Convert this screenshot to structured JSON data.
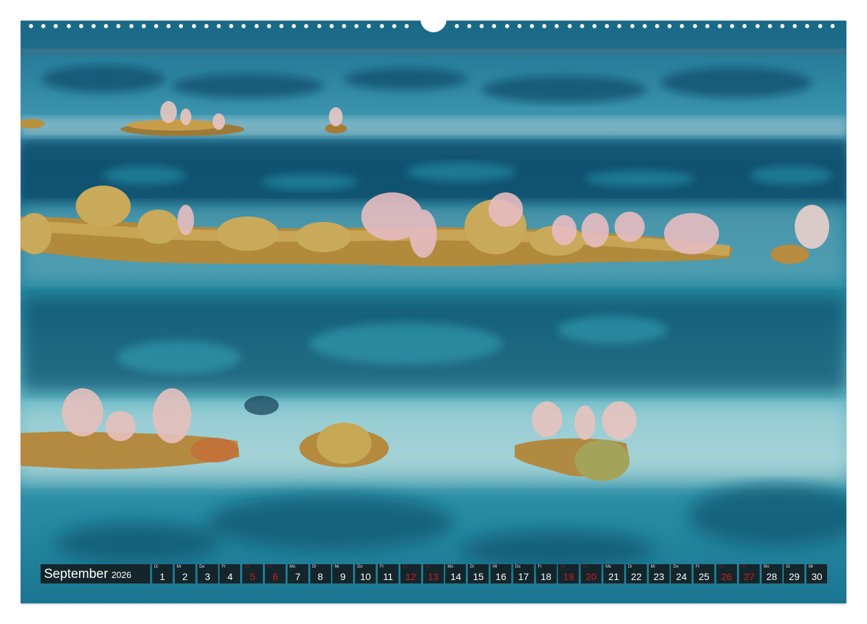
{
  "calendar": {
    "month": "September",
    "year": "2026",
    "colors": {
      "box": "#141e22",
      "text": "#ffffff",
      "weekend": "#d11b22"
    },
    "days": [
      {
        "wd": "Di",
        "num": "1",
        "weekend": false
      },
      {
        "wd": "Mi",
        "num": "2",
        "weekend": false
      },
      {
        "wd": "Do",
        "num": "3",
        "weekend": false
      },
      {
        "wd": "Fr",
        "num": "4",
        "weekend": false
      },
      {
        "wd": "Sa",
        "num": "5",
        "weekend": true
      },
      {
        "wd": "So",
        "num": "6",
        "weekend": true
      },
      {
        "wd": "Mo",
        "num": "7",
        "weekend": false
      },
      {
        "wd": "Di",
        "num": "8",
        "weekend": false
      },
      {
        "wd": "Mi",
        "num": "9",
        "weekend": false
      },
      {
        "wd": "Do",
        "num": "10",
        "weekend": false
      },
      {
        "wd": "Fr",
        "num": "11",
        "weekend": false
      },
      {
        "wd": "Sa",
        "num": "12",
        "weekend": true
      },
      {
        "wd": "So",
        "num": "13",
        "weekend": true
      },
      {
        "wd": "Mo",
        "num": "14",
        "weekend": false
      },
      {
        "wd": "Di",
        "num": "15",
        "weekend": false
      },
      {
        "wd": "Mi",
        "num": "16",
        "weekend": false
      },
      {
        "wd": "Do",
        "num": "17",
        "weekend": false
      },
      {
        "wd": "Fr",
        "num": "18",
        "weekend": false
      },
      {
        "wd": "Sa",
        "num": "19",
        "weekend": true
      },
      {
        "wd": "So",
        "num": "20",
        "weekend": true
      },
      {
        "wd": "Mo",
        "num": "21",
        "weekend": false
      },
      {
        "wd": "Di",
        "num": "22",
        "weekend": false
      },
      {
        "wd": "Mi",
        "num": "23",
        "weekend": false
      },
      {
        "wd": "Do",
        "num": "24",
        "weekend": false
      },
      {
        "wd": "Fr",
        "num": "25",
        "weekend": false
      },
      {
        "wd": "Sa",
        "num": "26",
        "weekend": true
      },
      {
        "wd": "So",
        "num": "27",
        "weekend": true
      },
      {
        "wd": "Mo",
        "num": "28",
        "weekend": false
      },
      {
        "wd": "Di",
        "num": "29",
        "weekend": false
      },
      {
        "wd": "Mi",
        "num": "30",
        "weekend": false
      }
    ]
  },
  "photo": {
    "palette": {
      "deep_water": "#0f4f6e",
      "mid_water": "#1e86a0",
      "light_water": "#5bb8c6",
      "shallow": "#a9d6dc",
      "vegetation": "#b8913f",
      "foliage_pink": "#e5b4b8"
    }
  }
}
